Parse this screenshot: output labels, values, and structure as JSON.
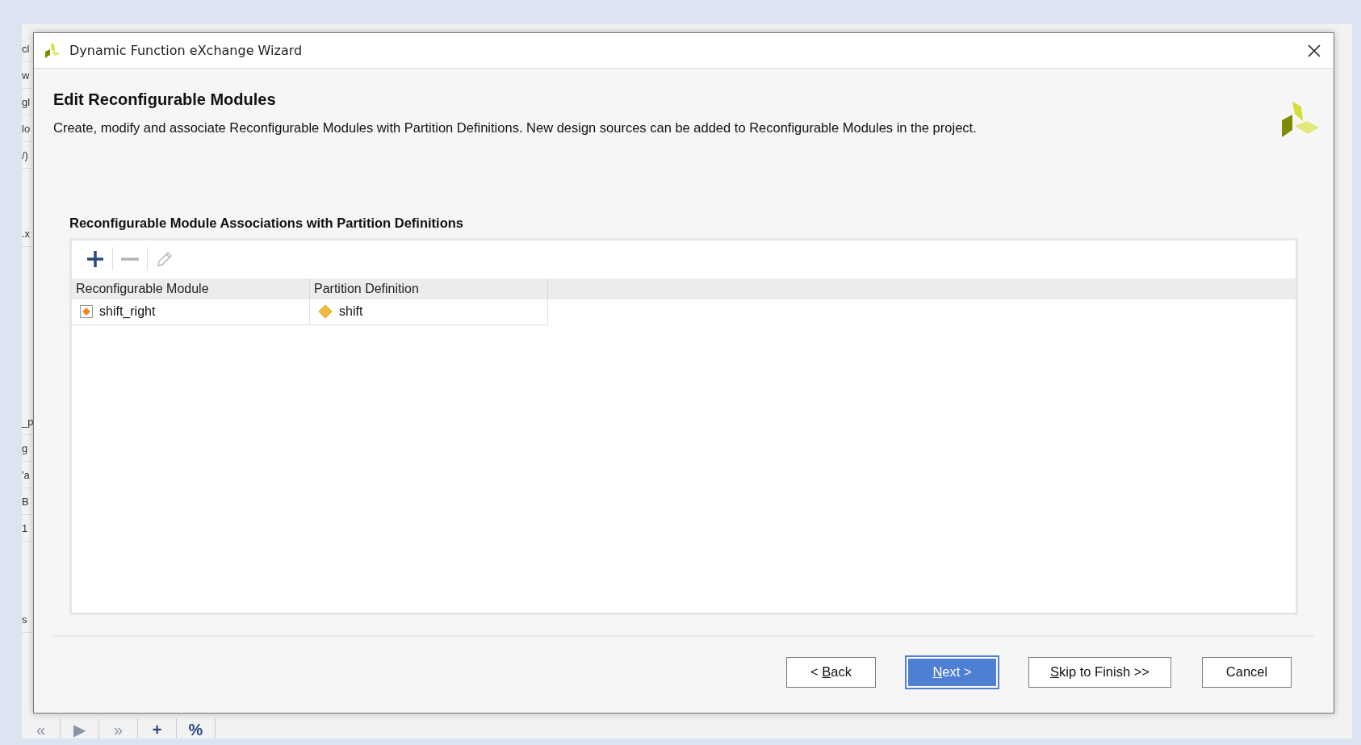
{
  "background_window": {
    "fragments": [
      "cl",
      "w",
      "gl",
      "lo",
      "/)",
      ".x",
      "_p",
      "g",
      "'a",
      "B",
      "1",
      "s"
    ],
    "bottom_toolbar": [
      "«",
      "▶",
      "»",
      "+",
      "%"
    ]
  },
  "dialog": {
    "title": "Dynamic Function eXchange Wizard",
    "heading": "Edit Reconfigurable Modules",
    "description": "Create, modify and associate Reconfigurable Modules with Partition Definitions. New design sources can be added to Reconfigurable Modules in the project.",
    "section_label": "Reconfigurable Module Associations with Partition Definitions",
    "toolbar": [
      {
        "kind": "add",
        "disabled": false
      },
      {
        "kind": "remove",
        "disabled": true
      },
      {
        "kind": "edit",
        "disabled": true
      }
    ],
    "table": {
      "columns": [
        "Reconfigurable Module",
        "Partition Definition"
      ],
      "rows": [
        {
          "module": "shift_right",
          "partition": "shift"
        }
      ]
    },
    "buttons": [
      {
        "prefix": "< ",
        "mnemonic": "B",
        "rest": "ack",
        "default": false
      },
      {
        "mnemonic": "N",
        "rest": "ext >",
        "default": true
      },
      {
        "mnemonic": "S",
        "rest": "kip to Finish >>",
        "default": false
      },
      {
        "rest": "Cancel",
        "default": false
      }
    ]
  }
}
